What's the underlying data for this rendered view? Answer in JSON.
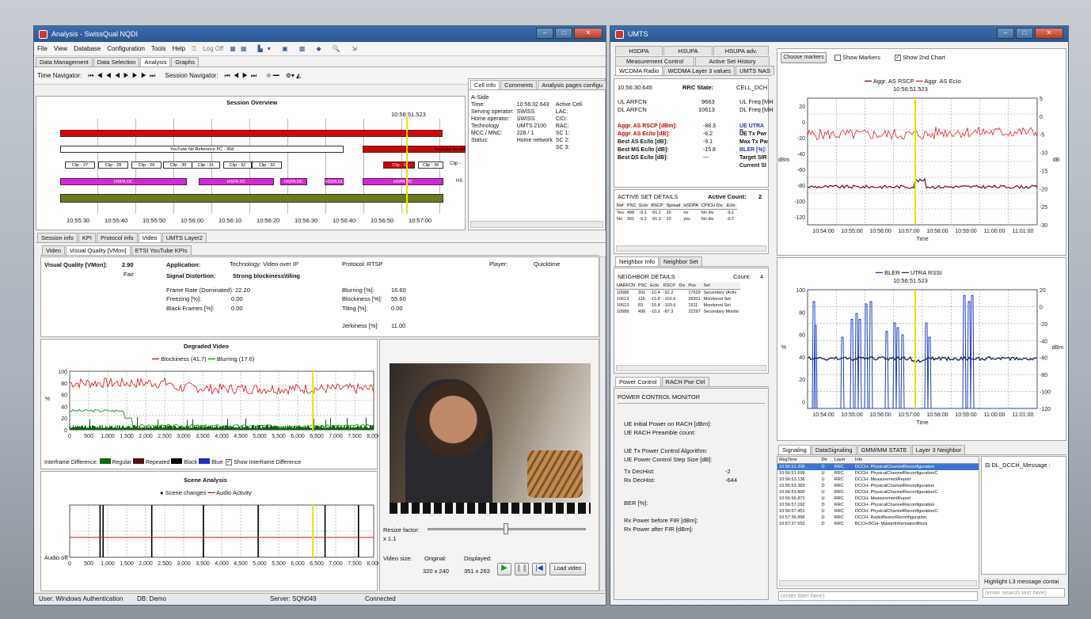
{
  "left_window": {
    "title": "Analysis - SwissQual NQDI",
    "menu": [
      "File",
      "View",
      "Database",
      "Configuration",
      "Tools",
      "Help"
    ],
    "logoff": "Log Off",
    "main_tabs": [
      "Data Management",
      "Data Selection",
      "Analysis",
      "Graphs"
    ],
    "time_navigator": "Time Navigator:",
    "session_navigator": "Session Navigator:",
    "session_overview": {
      "title": "Session Overview",
      "cursor_time": "10:56:51.523",
      "youtube_label": "YouTube No Reference PC - 958",
      "youtube_label2": "YouTube No Re",
      "clips": [
        "Clip - 27",
        "Clip - 28",
        "Clip - 29",
        "Clip - 30",
        "Clip - 31",
        "Clip - 32",
        "Clip - 33"
      ],
      "clip_a": "Clip - 3",
      "clip_b": "Clip - 36",
      "clip_c": "Clip -",
      "hspa": "HSPA DC",
      "hspa_short": "HS",
      "time_ticks": [
        "10:55:30",
        "10:55:40",
        "10:55:50",
        "10:56:00",
        "10:56:10",
        "10:56:20",
        "10:56:30",
        "10:56:40",
        "10:56:50",
        "10:57:00"
      ]
    },
    "cell_info": {
      "tabs": [
        "Cell info",
        "Comments",
        "Analysis pages configu"
      ],
      "side": "A-Side",
      "rows": [
        [
          "Time:",
          "10:56:32.643",
          "Active Cell"
        ],
        [
          "Serving operator:",
          "SWISS",
          "LAC:"
        ],
        [
          "Home operator:",
          "SWISS",
          "CID:"
        ],
        [
          "Technology",
          "UMTS 2100",
          "RAC:"
        ],
        [
          "MCC / MNC:",
          "228 / 1",
          "SC 1:"
        ],
        [
          "Status:",
          "Home network",
          "SC 2:"
        ],
        [
          "",
          "",
          "SC 3:"
        ]
      ]
    },
    "lower_tabs": [
      "Session info",
      "KPI",
      "Protocol info",
      "Video",
      "UMTS Layer2"
    ],
    "video_tabs": [
      "Video",
      "Visual Quality [VMon]",
      "ETSI YouTube KPIs"
    ],
    "vq": {
      "label": "Visual Quality [VMon]:",
      "value": "2.90",
      "rating": "Fair",
      "application": "Application:",
      "technology": "Technology: Video over IP",
      "protocol": "Protocol: RTSP",
      "player": "Player:",
      "player_value": "Quicktime",
      "signal_distortion": "Signal Distortion:",
      "distortion_value": "Strong blockiness\\tiling",
      "frame_rate": "Frame Rate (Dominated): 22.20",
      "freezing": "Freezing [%]:",
      "freezing_value": "0.00",
      "black": "Black Frames [%]:",
      "black_value": "0.00",
      "blurring": "Blurring [%]:",
      "blurring_value": "16.60",
      "blockiness": "Blockiness [%]:",
      "blockiness_value": "55.60",
      "tiling": "Tiling [%]:",
      "tiling_value": "0.00",
      "jerkiness": "Jerkiness [%]:",
      "jerkiness_value": "11.00"
    },
    "degraded": {
      "title": "Degraded Video",
      "legend1": "Blockiness (41.7)",
      "legend2": "Blurring (17.6)",
      "ylabel": "%"
    },
    "interframe": {
      "label": "Interframe Difference:",
      "regular": "Regular",
      "repeated": "Repeated",
      "black": "Black",
      "blue": "Blue",
      "show": "Show Interframe Difference"
    },
    "scene": {
      "title": "Scene Analysis",
      "legend1": "Scene changes",
      "legend2": "Audio Activity",
      "audio": "Audio off"
    },
    "x_ticks": [
      "0",
      "500",
      "1,000",
      "1,500",
      "2,000",
      "2,500",
      "3,000",
      "3,500",
      "4,000",
      "4,500",
      "5,000",
      "5,500",
      "6,000",
      "6,500",
      "7,000",
      "7,500",
      "8,000"
    ],
    "video_player": {
      "resize": "Resize factor:",
      "resize_value": "x 1.1",
      "size": "Video size:",
      "original": "Original:",
      "original_value": "320 x 240",
      "displayed": "Displayed:",
      "displayed_value": "351 x 263",
      "load": "Load video"
    },
    "status": {
      "user": "User: Windows Authentication",
      "db": "DB: Demo",
      "server": "Server: SQN049",
      "conn": "Connected"
    }
  },
  "right_window": {
    "title": "UMTS",
    "tabs_row1": [
      "HSDPA",
      "HSUPA",
      "HSUPA adv."
    ],
    "tabs_row2": [
      "Measurement Control",
      "Active Set History"
    ],
    "tabs_row3": [
      "WCDMA Radio",
      "WCDMA Layer 3 values",
      "UMTS NAS"
    ],
    "rrc": {
      "time": "10:56:30.645",
      "state_label": "RRC State:",
      "state": "CELL_DCH",
      "rows": [
        [
          "UL ARFCN",
          "9663",
          "UL Freq [MH"
        ],
        [
          "DL ARFCN",
          "10613",
          "DL Freq [MH"
        ]
      ]
    },
    "metrics": [
      [
        "Aggr. AS RSCP [dBm]:",
        "-88.3",
        "UE UTRA R"
      ],
      [
        "Aggr. AS Ec/Io [dB]:",
        "-6.2",
        "UE Tx Pwr"
      ],
      [
        "Best AS Ec/Io [dB]:",
        "-9.1",
        "Max Tx Pw"
      ],
      [
        "Best MS Ec/Io [dB]:",
        "-15.8",
        "BLER [%]:"
      ],
      [
        "Best DS Ec/Io [dB]:",
        "---",
        "Target SIR"
      ],
      [
        "",
        "",
        "Current SI"
      ]
    ],
    "active_set": {
      "label": "ACTIVE SET DETAILS",
      "count_label": "Active Count:",
      "count": "2",
      "headers": [
        "Ref",
        "PSC",
        "EcIo",
        "RSCP",
        "Spread",
        "HSDPA",
        "CPICH Div.",
        "EcIo"
      ],
      "rows": [
        [
          "Yes",
          "498",
          "-9.1",
          "-91.2",
          "20",
          "no",
          "No div",
          "-9.1"
        ],
        [
          "No",
          "391",
          "-9.2",
          "-91.3",
          "13",
          "yes",
          "No div",
          "-9.2"
        ]
      ]
    },
    "neighbor_tabs": [
      "Neighbor Info",
      "Neighbor Set"
    ],
    "neighbor": {
      "label": "NEIGHBOR DETAILS",
      "count_label": "Count:",
      "count": "4",
      "headers": [
        "UARFCN",
        "PSC",
        "EcIo",
        "RSCP",
        "Div",
        "Pos",
        "Set"
      ],
      "rows": [
        [
          "10588",
          "391",
          "-10.4",
          "-92.2",
          "",
          "17629",
          "Secondary (Activ"
        ],
        [
          "10613",
          "116",
          "-15.8",
          "-102.6",
          "",
          "28201",
          "Monitored Set"
        ],
        [
          "10613",
          "83",
          "-16.8",
          "-103.6",
          "",
          "1911",
          "Monitored Set"
        ],
        [
          "10588",
          "498",
          "-10.2",
          "-87.3",
          "",
          "22297",
          "Secondary Monito"
        ]
      ]
    },
    "power_tabs": [
      "Power Control",
      "RACH Pwr Ctrl"
    ],
    "power": {
      "title": "POWER CONTROL MONITOR",
      "l1": "UE initial Power on RACH [dBm]:",
      "l2": "UE RACH Preamble count:",
      "l3": "UE Tx Power Control Algorithm:",
      "l4": "UE Power Control Step Size [dB]:",
      "tx": "Tx DecHist:",
      "tx_v": "-2",
      "rx": "Rx DecHist:",
      "rx_v": "-644",
      "ber": "BER [%]:",
      "rx_before": "Rx Power before FIR [dBm]:",
      "rx_after": "Rx Power after FIR [dBm]:"
    },
    "chart_top": {
      "choose": "Choose markers",
      "show_markers": "Show Markers",
      "show_2nd": "Show 2nd Chart",
      "legend1": "Aggr. AS RSCP",
      "legend2": "Aggr. AS EcIo",
      "cursor": "10:56:51.523",
      "ylabel_left": "dBm",
      "ylabel_right": "dB",
      "xlabel": "Time"
    },
    "chart_bottom": {
      "legend1": "BLER",
      "legend2": "UTRA RSSI",
      "cursor": "10:56:51.523",
      "ylabel_left": "%",
      "ylabel_right": "dBm",
      "xlabel": "Time"
    },
    "time_ticks": [
      "10:54:00",
      "10:55:00",
      "10:56:00",
      "10:57:00",
      "10:58:00",
      "10:59:00",
      "11:00:00",
      "11:01:00"
    ],
    "sig_tabs": [
      "Signaling",
      "DataSignaling",
      "GMM/MM STATE",
      "Layer 3 Neighbor"
    ],
    "sig_headers": [
      "MsgTime",
      "Dir",
      "Layer",
      "Info"
    ],
    "sig_rows": [
      [
        "10:56:51.300",
        "D",
        "RRC",
        "DCCH- PhysicalChannelReconfiguration"
      ],
      [
        "10:56:51.699",
        "U",
        "RRC",
        "DCCH- PhysicalChannelReconfigurationC"
      ],
      [
        "10:56:53.136",
        "U",
        "RRC",
        "DCCH- MeasurementReport"
      ],
      [
        "10:56:53.383",
        "D",
        "RRC",
        "DCCH- PhysicalChannelReconfiguration"
      ],
      [
        "10:56:53.800",
        "U",
        "RRC",
        "DCCH- PhysicalChannelReconfigurationC"
      ],
      [
        "10:56:56.871",
        "U",
        "RRC",
        "DCCH- MeasurementReport"
      ],
      [
        "10:56:57.092",
        "D",
        "RRC",
        "DCCH- PhysicalChannelReconfiguration"
      ],
      [
        "10:56:57.451",
        "U",
        "RRC",
        "DCCH- PhysicalChannelReconfigurationC"
      ],
      [
        "10:57:36.856",
        "D",
        "RRC",
        "DCCH- RadioBearerReconfiguration"
      ],
      [
        "10:57:37.552",
        "D",
        "RRC",
        "BCCH:BCH- MasterInformationBlock"
      ]
    ],
    "msg_tree": "DL_DCCH_Message :",
    "filter_ph": "(enter filter here)",
    "highlight": "Highlight L3 message contai",
    "search_ph": "(enter search text here)"
  },
  "chart_data": [
    {
      "type": "line",
      "title": "",
      "series": [
        {
          "name": "Aggr. AS RSCP",
          "axis": "left"
        },
        {
          "name": "Aggr. AS EcIo",
          "axis": "right"
        }
      ],
      "ylim_left": [
        -125,
        30
      ],
      "ylim_right": [
        -30,
        5
      ],
      "x_ticks": [
        "10:54:00",
        "10:55:00",
        "10:56:00",
        "10:57:00",
        "10:58:00",
        "10:59:00",
        "11:00:00",
        "11:01:00"
      ],
      "xlabel": "Time"
    },
    {
      "type": "line",
      "title": "",
      "series": [
        {
          "name": "BLER",
          "axis": "left"
        },
        {
          "name": "UTRA RSSI",
          "axis": "right"
        }
      ],
      "ylim_left": [
        0,
        100
      ],
      "ylim_right": [
        -120,
        20
      ]
    },
    {
      "type": "line",
      "title": "Degraded Video",
      "series": [
        {
          "name": "Blockiness (41.7)"
        },
        {
          "name": "Blurring (17.6)"
        }
      ],
      "ylim": [
        0,
        100
      ],
      "xlim": [
        0,
        8000
      ]
    }
  ]
}
